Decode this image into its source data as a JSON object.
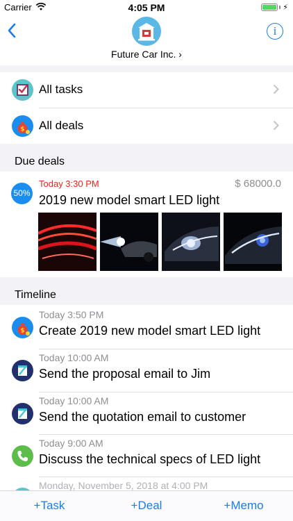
{
  "status_bar": {
    "carrier": "Carrier",
    "time": "4:05 PM"
  },
  "header": {
    "company_name": "Future Car Inc. ›",
    "info_label": "i"
  },
  "menu": [
    {
      "label": "All tasks",
      "icon": "tasks-checkbox-icon"
    },
    {
      "label": "All deals",
      "icon": "money-bag-icon"
    }
  ],
  "sections": {
    "due_deals": "Due deals",
    "timeline": "Timeline"
  },
  "due_deal": {
    "probability": "50%",
    "date": "Today 3:30 PM",
    "amount": "$ 68000.0",
    "title": "2019 new model smart LED light"
  },
  "timeline": [
    {
      "date": "Today 3:50 PM",
      "title": "Create 2019 new model smart LED light",
      "icon": "money-bag-icon"
    },
    {
      "date": "Today 10:00 AM",
      "title": "Send the proposal email to Jim",
      "icon": "email-icon"
    },
    {
      "date": "Today 10:00 AM",
      "title": "Send the quotation email to customer",
      "icon": "email-icon"
    },
    {
      "date": "Today 9:00 AM",
      "title": "Discuss the technical specs of LED light",
      "icon": "phone-icon"
    },
    {
      "date": "Monday, November 5, 2018 at 4:00 PM",
      "title": "",
      "icon": "meeting-icon"
    }
  ],
  "tabs": {
    "task": "+Task",
    "deal": "+Deal",
    "memo": "+Memo"
  },
  "colors": {
    "accent": "#1a7cf0",
    "due_date": "#e8271a",
    "section_bg": "#f2f2f7"
  }
}
